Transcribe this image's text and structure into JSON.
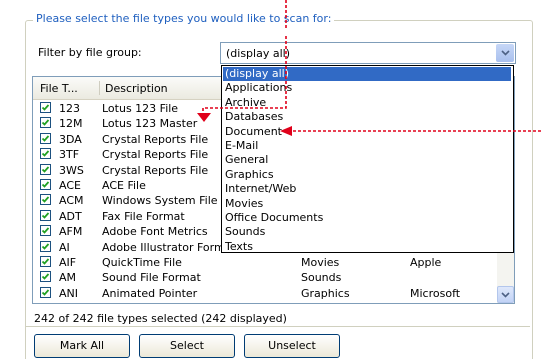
{
  "group_title": "Please select the file types you would like to scan for:",
  "filter": {
    "label": "Filter by file group:",
    "value": "(display all)",
    "options": [
      "(display all)",
      "Applications",
      "Archive",
      "Databases",
      "Document",
      "E-Mail",
      "General",
      "Graphics",
      "Internet/Web",
      "Movies",
      "Office Documents",
      "Sounds",
      "Texts"
    ]
  },
  "table": {
    "headers": [
      "File T...",
      "Description"
    ],
    "rows": [
      {
        "ext": "123",
        "desc": "Lotus 123 File",
        "group": "",
        "vendor": ""
      },
      {
        "ext": "12M",
        "desc": "Lotus 123 Master",
        "group": "",
        "vendor": ""
      },
      {
        "ext": "3DA",
        "desc": "Crystal Reports File",
        "group": "",
        "vendor": ""
      },
      {
        "ext": "3TF",
        "desc": "Crystal Reports File",
        "group": "",
        "vendor": ""
      },
      {
        "ext": "3WS",
        "desc": "Crystal Reports File",
        "group": "",
        "vendor": ""
      },
      {
        "ext": "ACE",
        "desc": "ACE File",
        "group": "",
        "vendor": ""
      },
      {
        "ext": "ACM",
        "desc": "Windows System File",
        "group": "",
        "vendor": ""
      },
      {
        "ext": "ADT",
        "desc": "Fax File Format",
        "group": "",
        "vendor": ""
      },
      {
        "ext": "AFM",
        "desc": "Adobe Font Metrics",
        "group": "",
        "vendor": ""
      },
      {
        "ext": "AI",
        "desc": "Adobe Illustrator Form",
        "group": "",
        "vendor": ""
      },
      {
        "ext": "AIF",
        "desc": "QuickTime File",
        "group": "Movies",
        "vendor": "Apple"
      },
      {
        "ext": "AM",
        "desc": "Sound File Format",
        "group": "Sounds",
        "vendor": ""
      },
      {
        "ext": "ANI",
        "desc": "Animated Pointer",
        "group": "Graphics",
        "vendor": "Microsoft"
      }
    ]
  },
  "status": "242 of 242 file types selected (242 displayed)",
  "buttons": {
    "mark_all": "Mark All",
    "select": "Select",
    "unselect": "Unselect"
  },
  "colors": {
    "legend": "#1f5fbf",
    "selection": "#316ac5",
    "annotation": "#e0001a"
  }
}
